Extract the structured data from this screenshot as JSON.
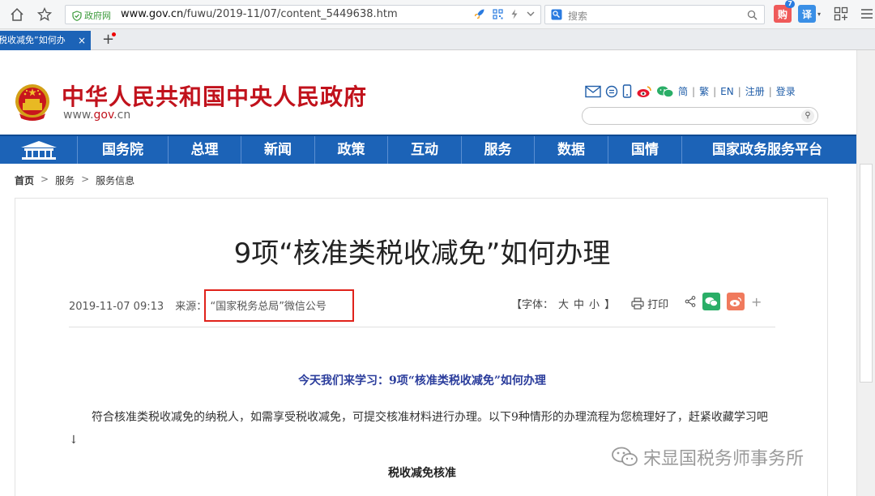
{
  "browser": {
    "security_label": "政府网",
    "url_host": "www.gov.cn",
    "url_path": "/fuwu/2019-11/07/content_5449638.htm",
    "search_placeholder": "搜索",
    "badge_count": "7",
    "translate_label": "译",
    "shop_label": "购",
    "tab_title": "税收减免”如何办",
    "tab_close": "×",
    "new_tab": "+"
  },
  "site": {
    "title": "中华人民共和国中央人民政府",
    "domain_prefix": "www.",
    "domain_highlight": "gov",
    "domain_suffix": ".cn",
    "links": [
      "简",
      "繁",
      "EN",
      "注册",
      "登录"
    ],
    "separator": "|"
  },
  "nav": {
    "items": [
      "国务院",
      "总理",
      "新闻",
      "政策",
      "互动",
      "服务",
      "数据",
      "国情",
      "国家政务服务平台"
    ]
  },
  "breadcrumb": {
    "items": [
      "首页",
      "服务",
      "服务信息"
    ],
    "separator": ">"
  },
  "article": {
    "title": "9项“核准类税收减免”如何办理",
    "datetime": "2019-11-07  09:13",
    "source_label": "来源：",
    "source": "“国家税务总局”微信公号",
    "font_label": "【字体：",
    "font_large": "大",
    "font_medium": "中",
    "font_small": "小",
    "font_close": "】",
    "print_label": "打印",
    "lead": "今天我们来学习：9项“核准类税收减免”如何办理",
    "paragraph": "符合核准类税收减免的纳税人，如需享受税收减免，可提交核准材料进行办理。以下9种情形的办理流程为您梳理好了，赶紧收藏学习吧↓",
    "subheading": "税收减免核准"
  },
  "watermark": {
    "text": "宋显国税务师事务所"
  },
  "colors": {
    "brand_red": "#c1121c",
    "nav_blue": "#1c63b7",
    "highlight_box": "#e0221b",
    "lead_blue": "#2b3d9c"
  }
}
